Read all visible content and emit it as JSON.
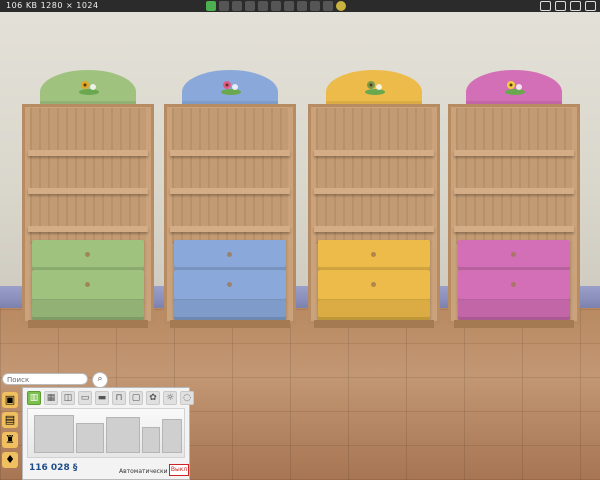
{
  "topbar": {
    "info": "106 KB  1280 × 1024"
  },
  "bookcases": [
    {
      "name": "green",
      "color": "#9fc27f",
      "accent": "#e1a726"
    },
    {
      "name": "blue",
      "color": "#8aa9da",
      "accent": "#e25b8a"
    },
    {
      "name": "yellow",
      "color": "#edbb49",
      "accent": "#7a9a4a"
    },
    {
      "name": "pink",
      "color": "#d36fb6",
      "accent": "#f1d040"
    }
  ],
  "catalog": {
    "search_placeholder": "Поиск",
    "search_icon": "search-icon",
    "price": "116 028 §",
    "mode_label": "Автоматически",
    "exit_label": "Выкл"
  }
}
